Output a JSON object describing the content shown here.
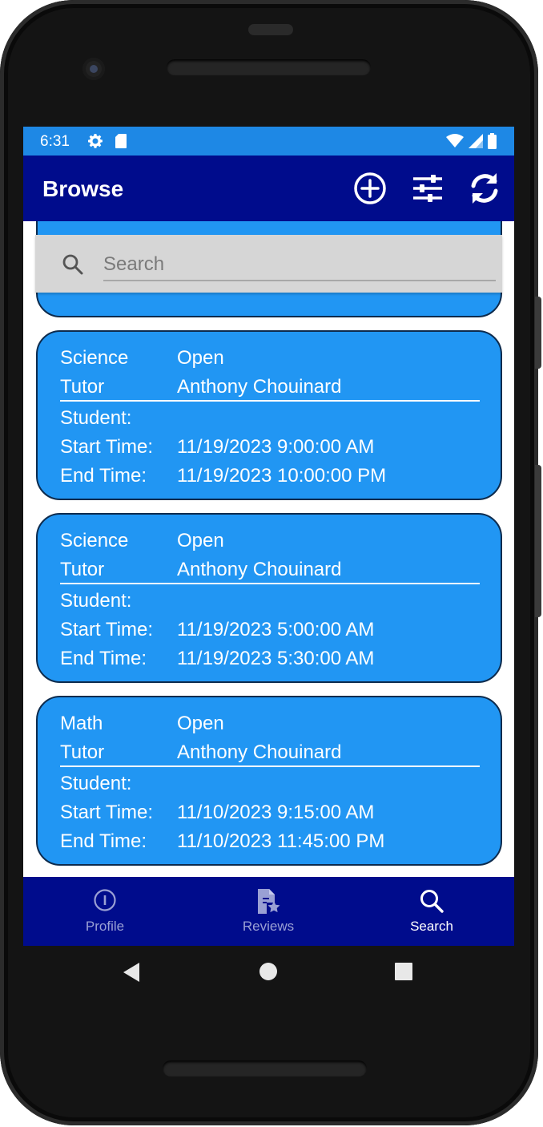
{
  "status_bar": {
    "time": "6:31",
    "gear_icon": "gear-icon",
    "sd_icon": "sd-card-icon",
    "wifi_icon": "wifi-icon",
    "signal_icon": "signal-icon",
    "battery_icon": "battery-icon"
  },
  "app_bar": {
    "title": "Browse",
    "add_icon": "add-circle-icon",
    "filter_icon": "filter-sliders-icon",
    "refresh_icon": "refresh-icon"
  },
  "search": {
    "placeholder": "Search",
    "value": ""
  },
  "sessions": [
    {
      "subject": "Science",
      "status": "Open",
      "tutor_label": "Tutor",
      "tutor": "Anthony Chouinard",
      "student_label": "Student:",
      "student": "",
      "start_label": "Start Time:",
      "start_time": "11/19/2023 9:00:00 AM",
      "end_label": "End Time:",
      "end_time": "11/19/2023 10:00:00 PM"
    },
    {
      "subject": "Science",
      "status": "Open",
      "tutor_label": "Tutor",
      "tutor": "Anthony Chouinard",
      "student_label": "Student:",
      "student": "",
      "start_label": "Start Time:",
      "start_time": "11/19/2023 5:00:00 AM",
      "end_label": "End Time:",
      "end_time": "11/19/2023 5:30:00 AM"
    },
    {
      "subject": "Math",
      "status": "Open",
      "tutor_label": "Tutor",
      "tutor": "Anthony Chouinard",
      "student_label": "Student:",
      "student": "",
      "start_label": "Start Time:",
      "start_time": "11/10/2023 9:15:00 AM",
      "end_label": "End Time:",
      "end_time": "11/10/2023 11:45:00 PM"
    }
  ],
  "bottom_nav": {
    "items": [
      {
        "label": "Profile",
        "icon": "info-icon",
        "active": false
      },
      {
        "label": "Reviews",
        "icon": "review-star-document-icon",
        "active": false
      },
      {
        "label": "Search",
        "icon": "search-icon",
        "active": true
      }
    ]
  },
  "colors": {
    "status_bar": "#1e88e5",
    "app_bar": "#000c8c",
    "card": "#2196f3",
    "nav_inactive": "#9aa0d4",
    "nav_active": "#ffffff"
  }
}
